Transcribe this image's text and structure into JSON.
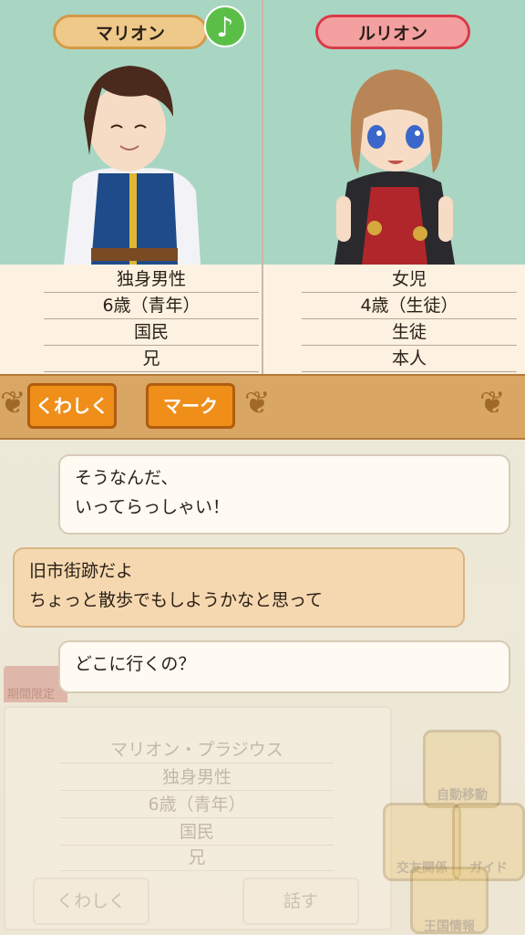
{
  "left_character": {
    "name": "マリオン",
    "info": [
      "独身男性",
      "6歳（青年）",
      "国民",
      "兄"
    ]
  },
  "right_character": {
    "name": "ルリオン",
    "info": [
      "女児",
      "4歳（生徒）",
      "生徒",
      "本人"
    ]
  },
  "actions": {
    "details_label": "くわしく",
    "mark_label": "マーク"
  },
  "music_icon": "♪",
  "chat": [
    {
      "speaker": "right",
      "lines": [
        "そうなんだ、",
        "いってらっしゃい！"
      ]
    },
    {
      "speaker": "left",
      "lines": [
        "旧市街跡だよ",
        "ちょっと散歩でもしようかなと思って"
      ]
    },
    {
      "speaker": "right",
      "lines": [
        "どこに行くの？"
      ]
    }
  ],
  "background_panel": {
    "limited_badge": "期間限定",
    "full_name": "マリオン・プラジウス",
    "info": [
      "独身男性",
      "6歳（青年）",
      "国民",
      "兄"
    ],
    "details_label": "くわしく",
    "talk_label": "話す",
    "menu": [
      "自動移動",
      "交友関係",
      "ガイド",
      "王国情報"
    ]
  },
  "colors": {
    "portrait_bg": "#a9d6c3",
    "button_orange": "#f08e1a",
    "male_pill": "#efc98a",
    "female_pill": "#f4a0a0"
  }
}
